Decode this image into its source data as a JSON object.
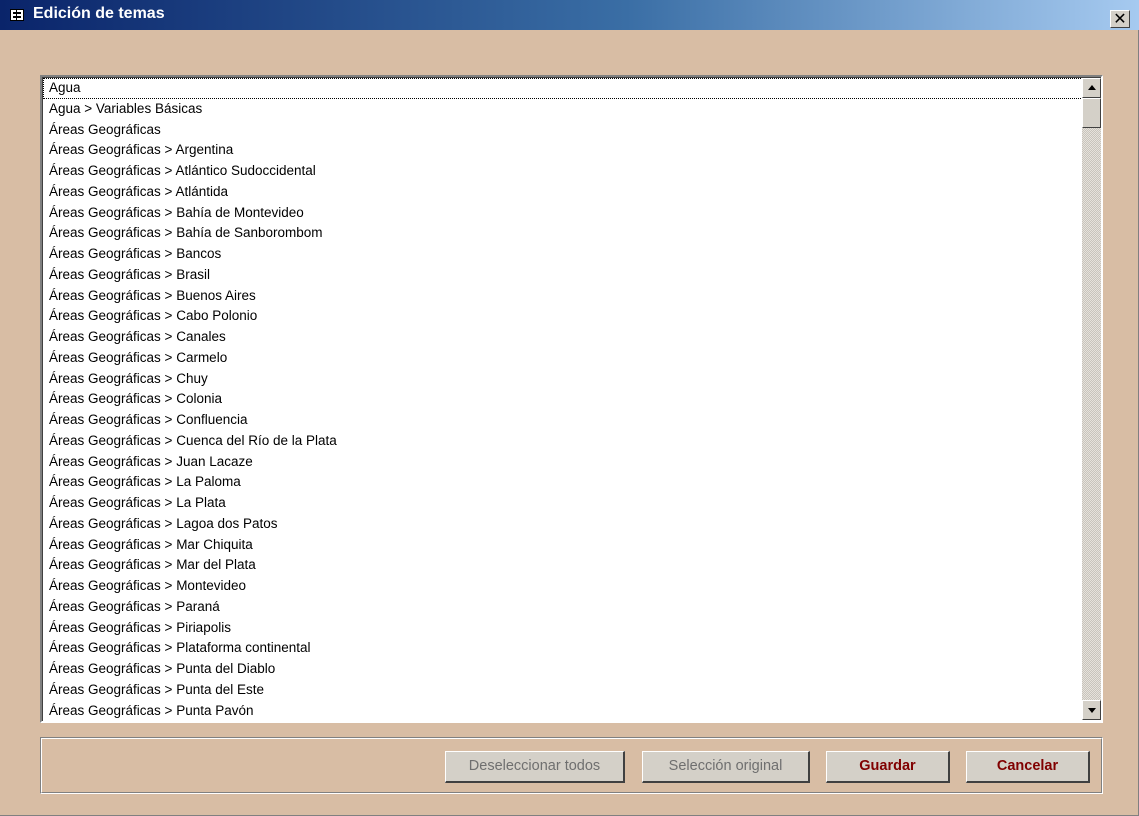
{
  "window": {
    "title": "Edición de temas",
    "close_glyph": "✕"
  },
  "list": {
    "items": [
      "Agua",
      "Agua > Variables Básicas",
      "Áreas Geográficas",
      "Áreas Geográficas > Argentina",
      "Áreas Geográficas > Atlántico Sudoccidental",
      "Áreas Geográficas > Atlántida",
      "Áreas Geográficas > Bahía de Montevideo",
      "Áreas Geográficas > Bahía de Sanborombom",
      "Áreas Geográficas > Bancos",
      "Áreas Geográficas > Brasil",
      "Áreas Geográficas > Buenos Aires",
      "Áreas Geográficas > Cabo Polonio",
      "Áreas Geográficas > Canales",
      "Áreas Geográficas > Carmelo",
      "Áreas Geográficas > Chuy",
      "Áreas Geográficas > Colonia",
      "Áreas Geográficas > Confluencia",
      "Áreas Geográficas > Cuenca del Río de la Plata",
      "Áreas Geográficas > Juan Lacaze",
      "Áreas Geográficas > La Paloma",
      "Áreas Geográficas > La Plata",
      "Áreas Geográficas > Lagoa dos Patos",
      "Áreas Geográficas > Mar Chiquita",
      "Áreas Geográficas > Mar del Plata",
      "Áreas Geográficas > Montevideo",
      "Áreas Geográficas > Paraná",
      "Áreas Geográficas > Piriapolis",
      "Áreas Geográficas > Plataforma continental",
      "Áreas Geográficas > Punta del Diablo",
      "Áreas Geográficas > Punta del Este",
      "Áreas Geográficas > Punta Pavón"
    ]
  },
  "buttons": {
    "deselect_all": "Deseleccionar todos",
    "original_selection": "Selección original",
    "save": "Guardar",
    "cancel": "Cancelar"
  },
  "colors": {
    "window_background": "#d8bda4",
    "title_gradient_start": "#0a246a",
    "title_gradient_end": "#a6caf0",
    "primary_button_text": "#800000"
  },
  "icons": {
    "app": "form-icon",
    "close": "close-icon",
    "scroll_up": "arrow-up-icon",
    "scroll_down": "arrow-down-icon"
  }
}
